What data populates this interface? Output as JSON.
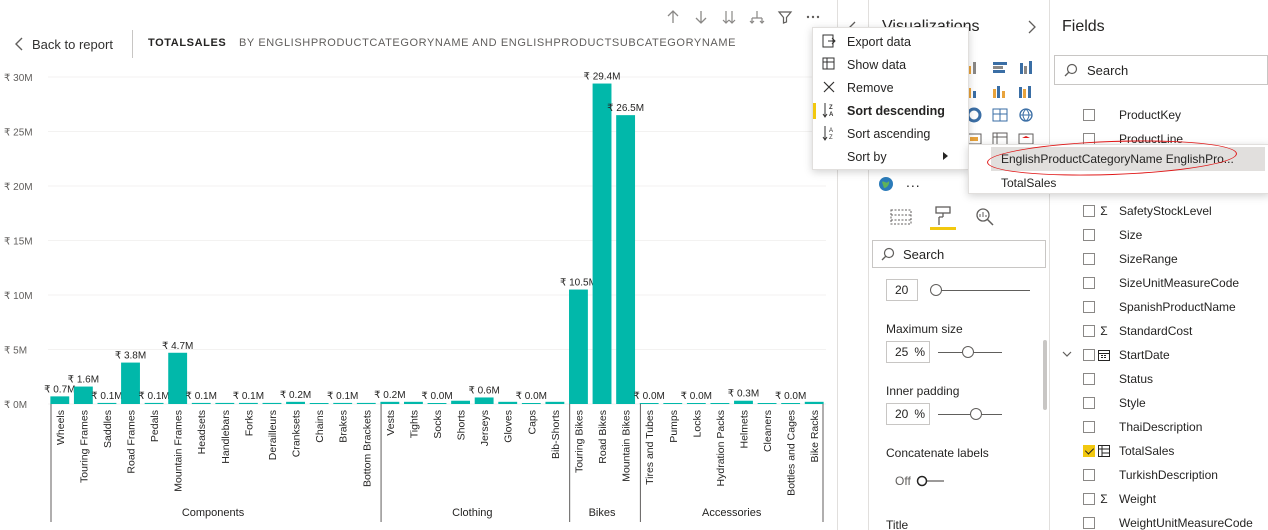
{
  "report": {
    "back_label": "Back to report",
    "title": "TOTALSALES",
    "subtitle": "BY ENGLISHPRODUCTCATEGORYNAME AND ENGLISHPRODUCTSUBCATEGORYNAME"
  },
  "visual_header_icons": [
    "drill-up-icon",
    "drill-down-icon",
    "expand-all-down-icon",
    "expand-hierarchy-icon",
    "filter-icon",
    "more-options-icon"
  ],
  "context_menu": {
    "items": [
      {
        "label": "Export data",
        "icon": "export-icon"
      },
      {
        "label": "Show data",
        "icon": "show-data-icon"
      },
      {
        "label": "Remove",
        "icon": "close-icon"
      },
      {
        "label": "Sort descending",
        "icon": "sort-descending-icon",
        "active": true
      },
      {
        "label": "Sort ascending",
        "icon": "sort-ascending-icon"
      },
      {
        "label": "Sort by",
        "icon": "",
        "submenu": true
      }
    ],
    "submenu": [
      "EnglishProductCategoryName EnglishPro...",
      "TotalSales"
    ]
  },
  "visualizations": {
    "title": "Visualizations",
    "search_placeholder": "Search",
    "font_size_value": "20",
    "max_size_label": "Maximum size",
    "max_size_value": "25",
    "max_size_unit": "%",
    "inner_padding_label": "Inner padding",
    "inner_padding_value": "20",
    "inner_padding_unit": "%",
    "concat_label": "Concatenate labels",
    "concat_toggle": "Off",
    "title_label": "Title",
    "more": "..."
  },
  "fields": {
    "title": "Fields",
    "search_placeholder": "Search",
    "items": [
      {
        "name": "ProductKey",
        "sigma": false,
        "checked": false
      },
      {
        "name": "ProductLine",
        "sigma": false,
        "checked": false
      },
      {
        "name": "SafetyStockLevel",
        "sigma": true,
        "checked": false
      },
      {
        "name": "Size",
        "sigma": false,
        "checked": false
      },
      {
        "name": "SizeRange",
        "sigma": false,
        "checked": false
      },
      {
        "name": "SizeUnitMeasureCode",
        "sigma": false,
        "checked": false
      },
      {
        "name": "SpanishProductName",
        "sigma": false,
        "checked": false
      },
      {
        "name": "StandardCost",
        "sigma": true,
        "checked": false
      },
      {
        "name": "StartDate",
        "sigma": false,
        "checked": false,
        "date": true
      },
      {
        "name": "Status",
        "sigma": false,
        "checked": false
      },
      {
        "name": "Style",
        "sigma": false,
        "checked": false
      },
      {
        "name": "ThaiDescription",
        "sigma": false,
        "checked": false
      },
      {
        "name": "TotalSales",
        "sigma": false,
        "checked": true,
        "table": true
      },
      {
        "name": "TurkishDescription",
        "sigma": false,
        "checked": false
      },
      {
        "name": "Weight",
        "sigma": true,
        "checked": false
      },
      {
        "name": "WeightUnitMeasureCode",
        "sigma": false,
        "checked": false
      }
    ]
  },
  "colors": {
    "bar": "#01b8aa",
    "accent": "#f2c80f",
    "annotation": "#e01818"
  },
  "chart_data": {
    "type": "bar",
    "title": "TOTALSALES",
    "ylim": [
      0,
      30000000
    ],
    "yticks": [
      {
        "value": 0,
        "label": "₹ 0M"
      },
      {
        "value": 5000000,
        "label": "₹ 5M"
      },
      {
        "value": 10000000,
        "label": "₹ 10M"
      },
      {
        "value": 15000000,
        "label": "₹ 15M"
      },
      {
        "value": 20000000,
        "label": "₹ 20M"
      },
      {
        "value": 25000000,
        "label": "₹ 25M"
      },
      {
        "value": 30000000,
        "label": "₹ 30M"
      }
    ],
    "groups": [
      {
        "name": "Components",
        "categories": [
          {
            "name": "Wheels",
            "value": 700000,
            "label": "₹ 0.7M"
          },
          {
            "name": "Touring Frames",
            "value": 1600000,
            "label": "₹ 1.6M"
          },
          {
            "name": "Saddles",
            "value": 100000,
            "label": "₹ 0.1M"
          },
          {
            "name": "Road Frames",
            "value": 3800000,
            "label": "₹ 3.8M"
          },
          {
            "name": "Pedals",
            "value": 100000,
            "label": "₹ 0.1M"
          },
          {
            "name": "Mountain Frames",
            "value": 4700000,
            "label": "₹ 4.7M"
          },
          {
            "name": "Headsets",
            "value": 100000,
            "label": "₹ 0.1M"
          },
          {
            "name": "Handlebars",
            "value": 100000,
            "label": "₹ 0.1M"
          },
          {
            "name": "Forks",
            "value": 100000,
            "label": "₹ 0.1M"
          },
          {
            "name": "Derailleurs",
            "value": 100000,
            "label": "₹ 0.1M"
          },
          {
            "name": "Cranksets",
            "value": 200000,
            "label": "₹ 0.2M"
          },
          {
            "name": "Chains",
            "value": 20000,
            "label": "₹ 0.0M"
          },
          {
            "name": "Brakes",
            "value": 100000,
            "label": "₹ 0.1M"
          },
          {
            "name": "Bottom Brackets",
            "value": 100000,
            "label": "₹ 0.1M"
          }
        ]
      },
      {
        "name": "Clothing",
        "categories": [
          {
            "name": "Vests",
            "value": 200000,
            "label": "₹ 0.2M"
          },
          {
            "name": "Tights",
            "value": 200000,
            "label": "₹ 0.2M"
          },
          {
            "name": "Socks",
            "value": 20000,
            "label": "₹ 0.0M"
          },
          {
            "name": "Shorts",
            "value": 300000,
            "label": "₹ 0.3M"
          },
          {
            "name": "Jerseys",
            "value": 600000,
            "label": "₹ 0.6M"
          },
          {
            "name": "Gloves",
            "value": 200000,
            "label": "₹ 0.2M"
          },
          {
            "name": "Caps",
            "value": 20000,
            "label": "₹ 0.0M"
          },
          {
            "name": "Bib-Shorts",
            "value": 200000,
            "label": "₹ 0.2M"
          }
        ]
      },
      {
        "name": "Bikes",
        "categories": [
          {
            "name": "Touring Bikes",
            "value": 10500000,
            "label": "₹ 10.5M"
          },
          {
            "name": "Road Bikes",
            "value": 29400000,
            "label": "₹ 29.4M"
          },
          {
            "name": "Mountain Bikes",
            "value": 26500000,
            "label": "₹ 26.5M"
          }
        ]
      },
      {
        "name": "Accessories",
        "categories": [
          {
            "name": "Tires and Tubes",
            "value": 20000,
            "label": "₹ 0.0M"
          },
          {
            "name": "Pumps",
            "value": 20000,
            "label": "₹ 0.0M"
          },
          {
            "name": "Locks",
            "value": 20000,
            "label": "₹ 0.0M"
          },
          {
            "name": "Hydration Packs",
            "value": 20000,
            "label": "₹ 0.0M"
          },
          {
            "name": "Helmets",
            "value": 300000,
            "label": "₹ 0.3M"
          },
          {
            "name": "Cleaners",
            "value": 20000,
            "label": "₹ 0.0M"
          },
          {
            "name": "Bottles and Cages",
            "value": 20000,
            "label": "₹ 0.0M"
          },
          {
            "name": "Bike Racks",
            "value": 200000,
            "label": "₹ 0.2M"
          }
        ]
      }
    ],
    "visible_data_labels": [
      "Wheels",
      "Touring Frames",
      "Saddles",
      "Road Frames",
      "Pedals",
      "Mountain Frames",
      "Headsets",
      "Forks",
      "Cranksets",
      "Brakes",
      "Vests",
      "Socks",
      "Jerseys",
      "Caps",
      "Touring Bikes",
      "Road Bikes",
      "Mountain Bikes",
      "Tires and Tubes",
      "Locks",
      "Helmets",
      "Bottles and Cages"
    ],
    "grid": true,
    "legend": "none"
  }
}
